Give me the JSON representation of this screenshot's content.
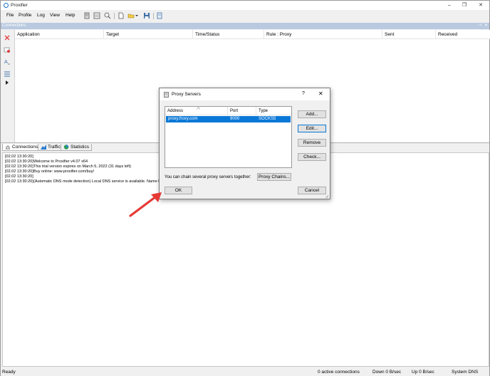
{
  "window": {
    "title": "Proxifier",
    "min": "–",
    "max": "❐",
    "close": "✕"
  },
  "menu": [
    "File",
    "Profile",
    "Log",
    "View",
    "Help"
  ],
  "connections": {
    "panel_title": "Connections",
    "columns": [
      "Application",
      "Target",
      "Time/Status",
      "Rule : Proxy",
      "Sent",
      "Received"
    ]
  },
  "tabs": [
    "Connections",
    "Traffic",
    "Statistics"
  ],
  "log": [
    {
      "ts": "[02.02 13:30:20]",
      "msg": ""
    },
    {
      "ts": "[02.02 13:30:20]",
      "msg": "Welcome to Proxifier v4.07 x64"
    },
    {
      "ts": "[02.02 13:30:20]",
      "msg": "This trial version expires on March 5, 2022 (31 days left)"
    },
    {
      "ts": "[02.02 13:30:20]",
      "msg": "Buy online: www.proxifier.com/buy/"
    },
    {
      "ts": "[02.02 13:30:20]",
      "msg": ""
    },
    {
      "ts": "[02.02 13:30:20]",
      "msg": "(Automatic DNS mode detection) Local DNS service is available. Name Resolu"
    }
  ],
  "status": {
    "left": "Ready",
    "connections": "0 active connections",
    "down": "Down 0 B/sec",
    "up": "Up 0 B/sec",
    "dns": "System DNS"
  },
  "dialog": {
    "title": "Proxy Servers",
    "help": "?",
    "close": "✕",
    "columns": [
      "Address",
      "Port",
      "Type"
    ],
    "rows": [
      {
        "address": "proxy.froxy.com",
        "port": "9000",
        "type": "SOCKS5"
      }
    ],
    "buttons": {
      "add": "Add...",
      "edit": "Edit...",
      "remove": "Remove",
      "check": "Check..."
    },
    "chain_text": "You can chain several proxy servers together:",
    "proxy_chains": "Proxy Chains...",
    "ok": "OK",
    "cancel": "Cancel"
  },
  "colors": {
    "accent": "#0a78d7",
    "arrow": "#e53935",
    "panel_header": "#b9c9e0"
  }
}
